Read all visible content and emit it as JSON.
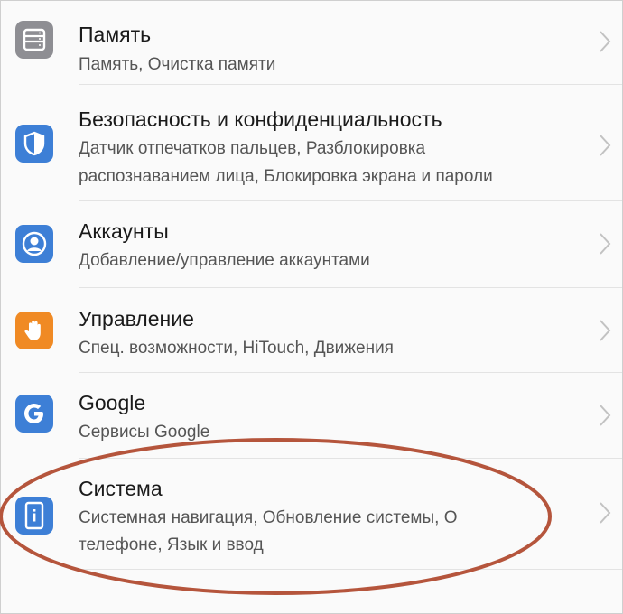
{
  "settings": {
    "items": [
      {
        "id": "memory",
        "title": "Память",
        "subtitle": [
          "Память, Очистка памяти"
        ],
        "icon": "storage-icon"
      },
      {
        "id": "security",
        "title": "Безопасность и конфиденциальность",
        "subtitle": [
          "Датчик отпечатков пальцев, Разблокировка",
          "распознаванием лица, Блокировка экрана и пароли"
        ],
        "icon": "shield-icon"
      },
      {
        "id": "accounts",
        "title": "Аккаунты",
        "subtitle": [
          "Добавление/управление аккаунтами"
        ],
        "icon": "account-icon"
      },
      {
        "id": "control",
        "title": "Управление",
        "subtitle": [
          "Спец. возможности, HiTouch, Движения"
        ],
        "icon": "hand-icon"
      },
      {
        "id": "google",
        "title": "Google",
        "subtitle": [
          "Сервисы Google"
        ],
        "icon": "google-icon"
      },
      {
        "id": "system",
        "title": "Система",
        "subtitle": [
          "Системная навигация, Обновление системы, О",
          "телефоне, Язык и ввод"
        ],
        "icon": "phone-info-icon"
      }
    ]
  },
  "colors": {
    "icon_gray": "#8e8e93",
    "icon_blue": "#3d7fd6",
    "icon_orange": "#f08a24",
    "highlight_oval": "#b5553c"
  }
}
